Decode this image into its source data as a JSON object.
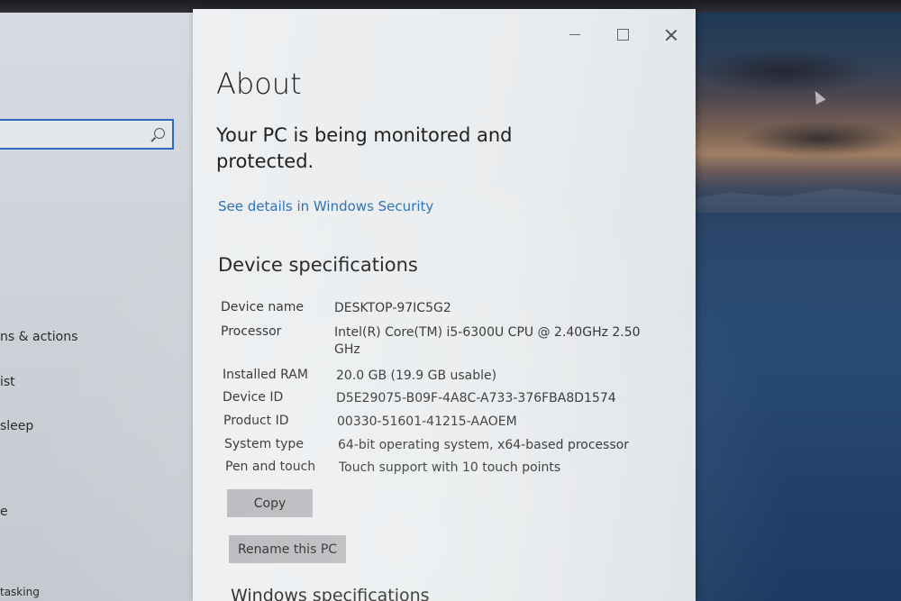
{
  "nav": {
    "items": [
      {
        "label": "ns & actions"
      },
      {
        "label": "ist"
      },
      {
        "label": "sleep"
      },
      {
        "label": "e"
      },
      {
        "label": "tasking"
      }
    ]
  },
  "window": {
    "title": "About",
    "protection_message": "Your PC is being monitored and protected.",
    "security_link": "See details in Windows Security",
    "device_section_title": "Device specifications",
    "specs": [
      {
        "label": "Device name",
        "value": "DESKTOP-97IC5G2"
      },
      {
        "label": "Processor",
        "value": "Intel(R) Core(TM) i5-6300U CPU @ 2.40GHz   2.50 GHz"
      },
      {
        "label": "Installed RAM",
        "value": "20.0 GB (19.9 GB usable)"
      },
      {
        "label": "Device ID",
        "value": "D5E29075-B09F-4A8C-A733-376FBA8D1574"
      },
      {
        "label": "Product ID",
        "value": "00330-51601-41215-AAOEM"
      },
      {
        "label": "System type",
        "value": "64-bit operating system, x64-based processor"
      },
      {
        "label": "Pen and touch",
        "value": "Touch support with 10 touch points"
      }
    ],
    "copy_label": "Copy",
    "rename_label": "Rename this PC",
    "windows_section_title": "Windows specifications"
  },
  "colors": {
    "accent": "#2a6bc2",
    "link": "#2a6db5",
    "button": "#b5b7ba"
  }
}
